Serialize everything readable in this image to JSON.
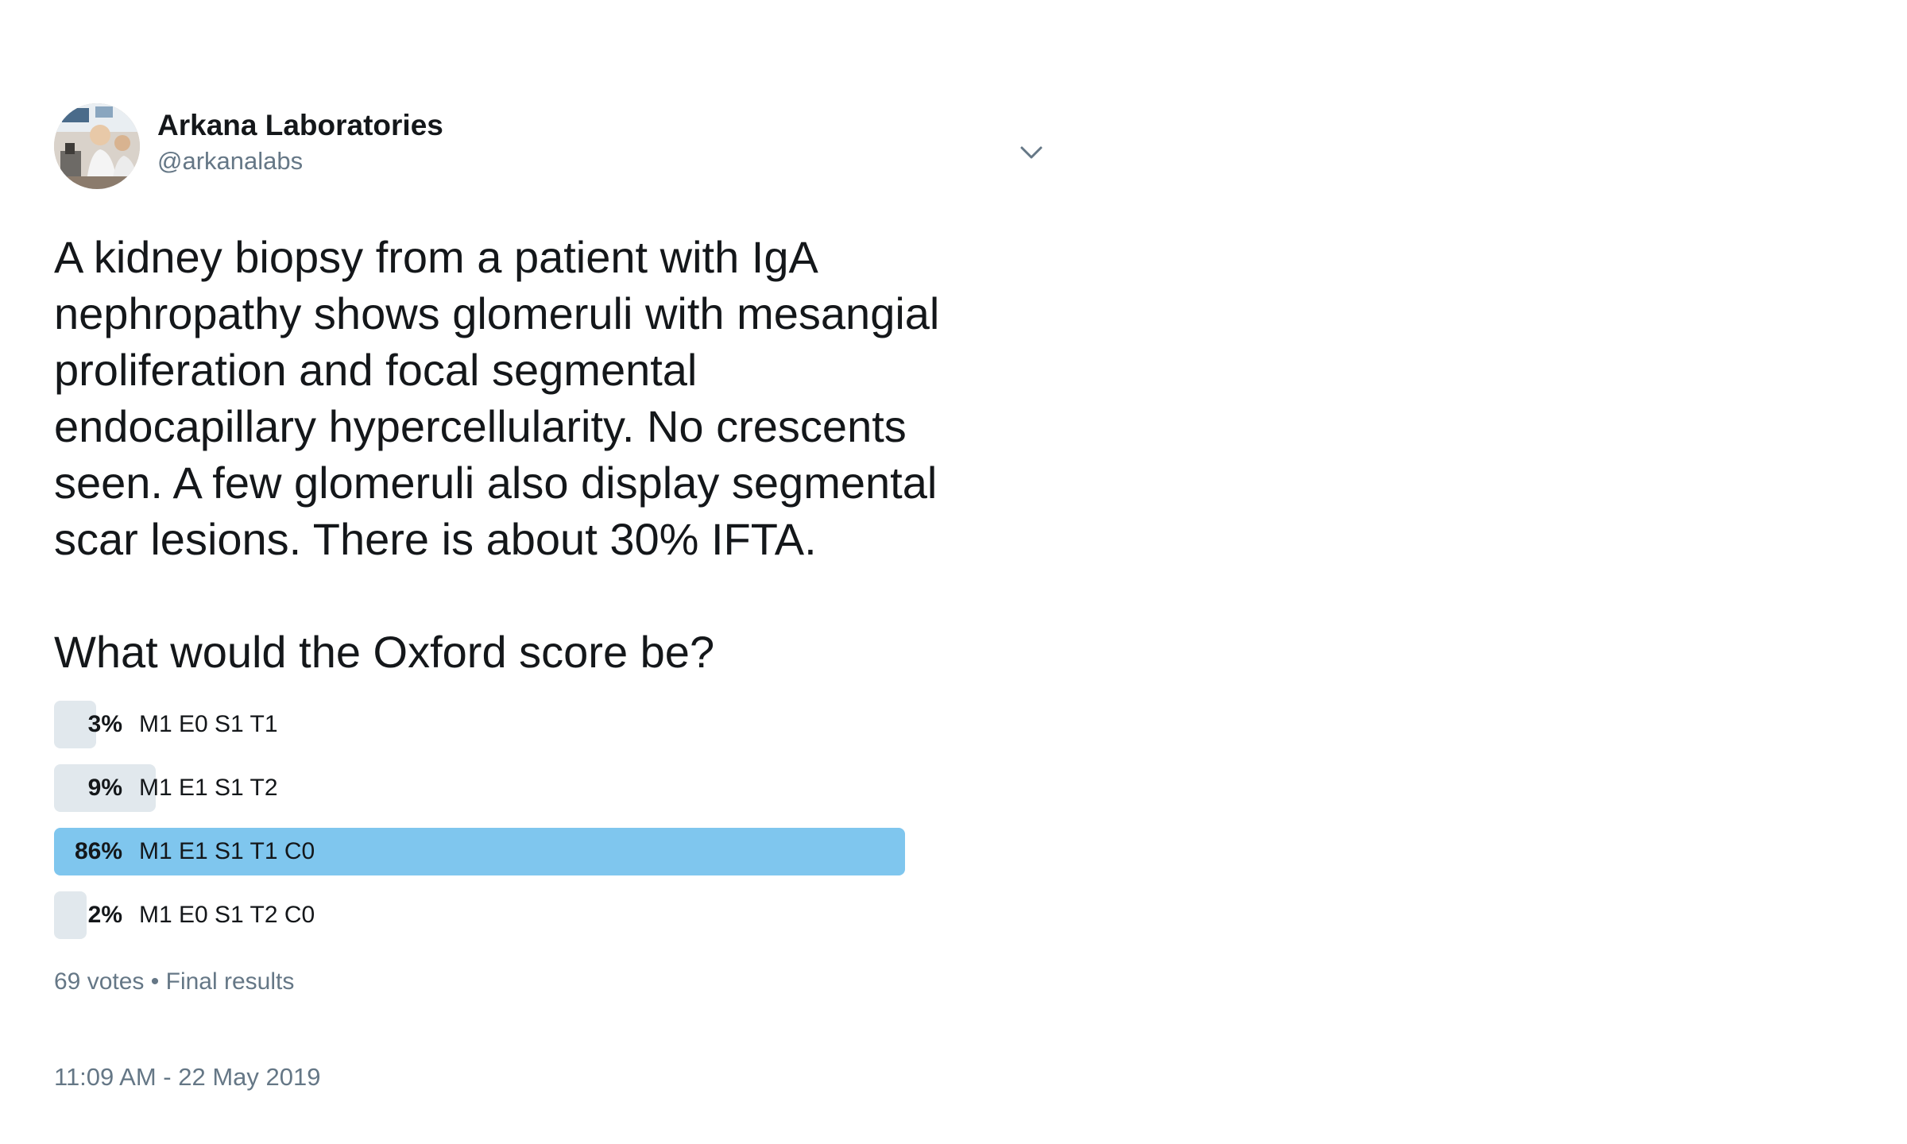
{
  "tweet": {
    "author": {
      "display_name": "Arkana Laboratories",
      "handle": "@arkanalabs",
      "avatar_icon": "lab-photo-avatar"
    },
    "menu_icon": "chevron-down-icon",
    "text": "A kidney biopsy from a patient with IgA\nnephropathy shows glomeruli with mesangial\nproliferation and focal segmental\nendocapillary hypercellularity. No crescents\nseen. A few glomeruli also display segmental\nscar lesions. There is about 30% IFTA.\n\nWhat would the Oxford score be?",
    "poll": {
      "options": [
        {
          "percent_label": "3%",
          "percent": 3,
          "label": "M1 E0 S1 T1"
        },
        {
          "percent_label": "9%",
          "percent": 9,
          "label": "M1 E1 S1 T2"
        },
        {
          "percent_label": "86%",
          "percent": 86,
          "label": "M1 E1 S1 T1 C0"
        },
        {
          "percent_label": "2%",
          "percent": 2,
          "label": "M1 E0 S1 T2 C0"
        }
      ],
      "winner_index": 2,
      "votes": "69 votes",
      "separator": "•",
      "status": "Final results"
    },
    "timestamp": "11:09 AM - 22 May 2019"
  },
  "colors": {
    "winner_bar": "#7fc6ee",
    "bar": "#e1e8ed",
    "secondary_text": "#657786",
    "primary_text": "#14171a"
  }
}
